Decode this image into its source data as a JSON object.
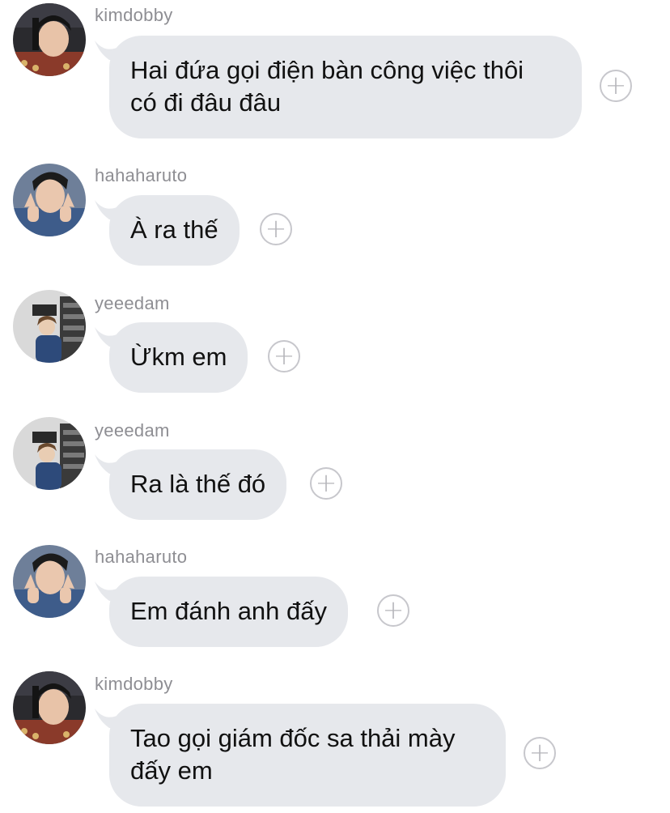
{
  "messages": [
    {
      "username": "kimdobby",
      "text": "Hai đứa gọi điện bàn công việc thôi\ncó đi đâu đâu",
      "avatar_icon": "kimdobby-avatar"
    },
    {
      "username": "hahaharuto",
      "text": "À ra thế",
      "avatar_icon": "hahaharuto-avatar"
    },
    {
      "username": "yeeedam",
      "text": "Ừkm em",
      "avatar_icon": "yeeedam-avatar"
    },
    {
      "username": "yeeedam",
      "text": "Ra là thế đó",
      "avatar_icon": "yeeedam-avatar"
    },
    {
      "username": "hahaharuto",
      "text": "Em đánh anh đấy",
      "avatar_icon": "hahaharuto-avatar"
    },
    {
      "username": "kimdobby",
      "text": "Tao gọi giám đốc sa thải mày\nđấy em",
      "avatar_icon": "kimdobby-avatar"
    }
  ],
  "add_reaction_symbol": "+",
  "colors": {
    "bubble_background": "#e6e8ec",
    "username_text": "#8e8e93",
    "message_text": "#111111",
    "add_button_border": "#c7c7cc"
  }
}
